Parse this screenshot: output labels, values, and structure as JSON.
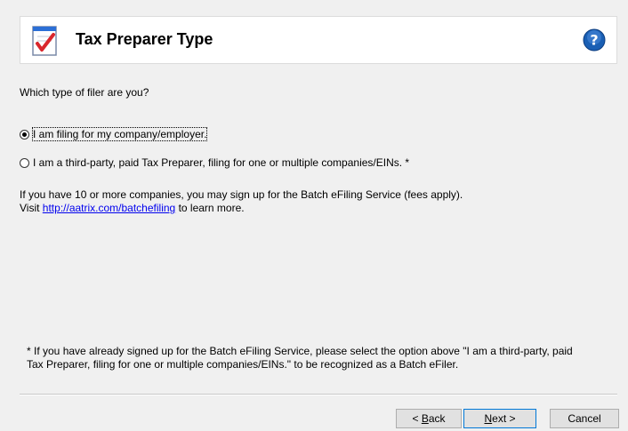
{
  "header": {
    "title": "Tax Preparer Type",
    "icon": "checklist-icon",
    "help_icon": "help-icon"
  },
  "question": "Which type of filer are you?",
  "options": [
    {
      "label": "I am filing for my company/employer.",
      "selected": true
    },
    {
      "label": "I am a third-party, paid Tax Preparer, filing for one or multiple companies/EINs. *",
      "selected": false
    }
  ],
  "batch_info": {
    "line1": "If you have 10 or more companies, you may sign up for the Batch eFiling Service (fees apply).",
    "visit": "Visit",
    "link": "http://aatrix.com/batchefiling",
    "suffix": "to learn more."
  },
  "footnote": {
    "line1": "* If you have already signed up for the Batch eFiling Service, please select the option above \"I am a third-party, paid",
    "line2": "Tax Preparer, filing for one or multiple companies/EINs.\" to be recognized as a Batch eFiler."
  },
  "buttons": {
    "back_prefix": "< ",
    "back_key": "B",
    "back_rest": "ack",
    "next_key": "N",
    "next_rest": "ext >",
    "cancel": "Cancel"
  },
  "colors": {
    "link": "#0000ee",
    "help": "#1a5fb4",
    "check": "#d9262c",
    "default_button_border": "#0078d7"
  }
}
